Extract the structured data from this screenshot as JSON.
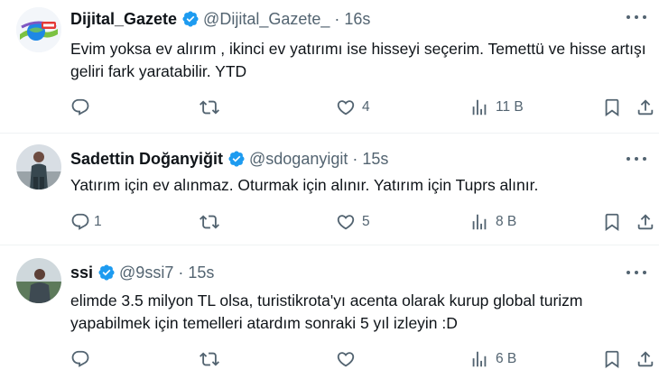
{
  "tweets": [
    {
      "name": "Dijital_Gazete",
      "handle": "@Dijital_Gazete_",
      "time": "16s",
      "dot": "·",
      "text": "Evim yoksa ev alırım , ikinci ev yatırımı ise hisseyi seçerim. Temettü ve hisse artışı geliri fark yaratabilir. YTD",
      "replies": "",
      "retweets": "",
      "likes": "4",
      "views": "11 B",
      "avatar": "news-logo"
    },
    {
      "name": "Sadettin Doğanyiğit",
      "handle": "@sdoganyigit",
      "time": "15s",
      "dot": "·",
      "text": "Yatırım için ev alınmaz. Oturmak için alınır. Yatırım için Tuprs alınır.",
      "replies": "1",
      "retweets": "",
      "likes": "5",
      "views": "8 B",
      "avatar": "man-standing-photo"
    },
    {
      "name": "ssi",
      "handle": "@9ssi7",
      "time": "15s",
      "dot": "·",
      "text": "elimde 3.5 milyon TL olsa, turistikrota'yı acenta olarak kurup global turizm yapabilmek için temelleri atardım sonraki 5 yıl izleyin :D",
      "replies": "",
      "retweets": "",
      "likes": "",
      "views": "6 B",
      "avatar": "man-outdoor-photo"
    }
  ],
  "colors": {
    "verified": "#1d9bf0",
    "secondary_text": "#536471",
    "primary_text": "#0f1419",
    "divider": "#eff3f4"
  }
}
